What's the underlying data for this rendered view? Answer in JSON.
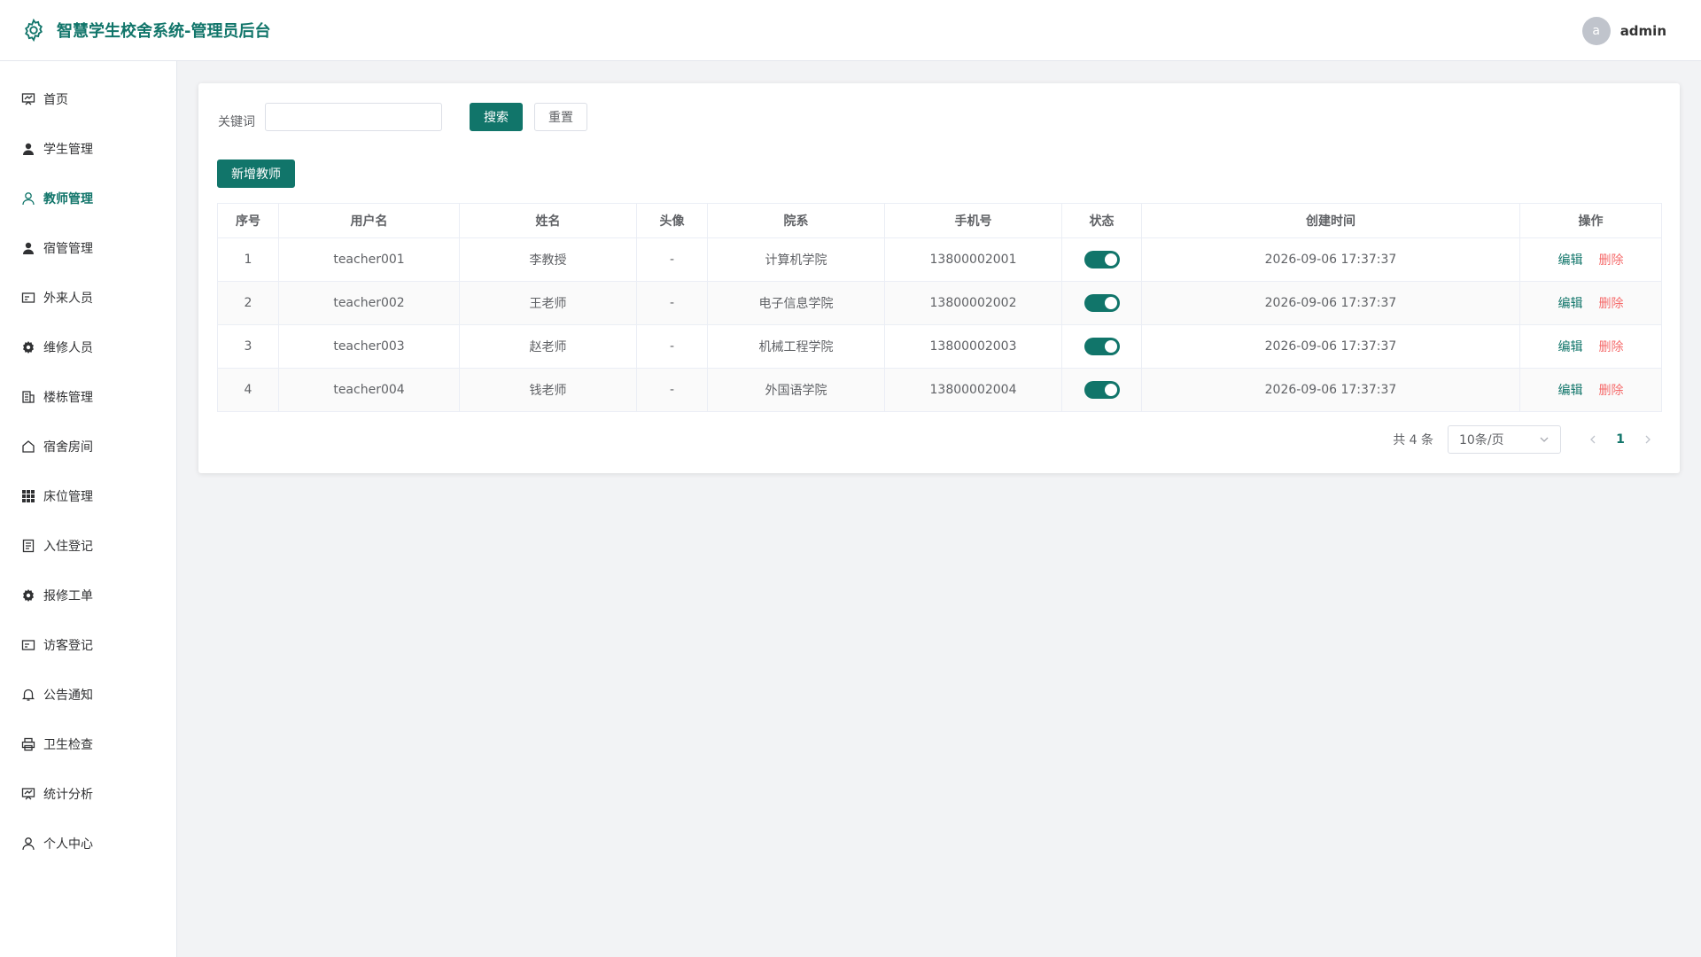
{
  "header": {
    "title": "智慧学生校舍系统-管理员后台",
    "user": {
      "avatar_letter": "a",
      "name": "admin"
    }
  },
  "sidebar": {
    "items": [
      {
        "label": "首页",
        "icon": "dashboard-icon"
      },
      {
        "label": "学生管理",
        "icon": "user-filled-icon"
      },
      {
        "label": "教师管理",
        "icon": "user-icon",
        "active": true
      },
      {
        "label": "宿管管理",
        "icon": "user-filled-icon"
      },
      {
        "label": "外来人员",
        "icon": "id-card-icon"
      },
      {
        "label": "维修人员",
        "icon": "gear-icon"
      },
      {
        "label": "楼栋管理",
        "icon": "building-icon"
      },
      {
        "label": "宿舍房间",
        "icon": "house-icon"
      },
      {
        "label": "床位管理",
        "icon": "grid-icon"
      },
      {
        "label": "入住登记",
        "icon": "document-icon"
      },
      {
        "label": "报修工单",
        "icon": "gear-icon"
      },
      {
        "label": "访客登记",
        "icon": "id-card-icon"
      },
      {
        "label": "公告通知",
        "icon": "bell-icon"
      },
      {
        "label": "卫生检查",
        "icon": "printer-icon"
      },
      {
        "label": "统计分析",
        "icon": "dashboard-icon"
      },
      {
        "label": "个人中心",
        "icon": "user-icon"
      }
    ]
  },
  "search": {
    "label": "关键词",
    "value": "",
    "placeholder": "",
    "search_label": "搜索",
    "reset_label": "重置"
  },
  "add_button_label": "新增教师",
  "table": {
    "columns": [
      "序号",
      "用户名",
      "姓名",
      "头像",
      "院系",
      "手机号",
      "状态",
      "创建时间",
      "操作"
    ],
    "rows": [
      {
        "index": "1",
        "username": "teacher001",
        "name": "李教授",
        "avatar": "-",
        "department": "计算机学院",
        "phone": "13800002001",
        "status": true,
        "created": "2026-09-06 17:37:37"
      },
      {
        "index": "2",
        "username": "teacher002",
        "name": "王老师",
        "avatar": "-",
        "department": "电子信息学院",
        "phone": "13800002002",
        "status": true,
        "created": "2026-09-06 17:37:37"
      },
      {
        "index": "3",
        "username": "teacher003",
        "name": "赵老师",
        "avatar": "-",
        "department": "机械工程学院",
        "phone": "13800002003",
        "status": true,
        "created": "2026-09-06 17:37:37"
      },
      {
        "index": "4",
        "username": "teacher004",
        "name": "钱老师",
        "avatar": "-",
        "department": "外国语学院",
        "phone": "13800002004",
        "status": true,
        "created": "2026-09-06 17:37:37"
      }
    ],
    "edit_label": "编辑",
    "delete_label": "删除"
  },
  "pagination": {
    "total_text": "共 4 条",
    "page_size": "10条/页",
    "current_page": "1"
  },
  "colors": {
    "primary": "#11756a",
    "danger": "#f56c6c"
  }
}
